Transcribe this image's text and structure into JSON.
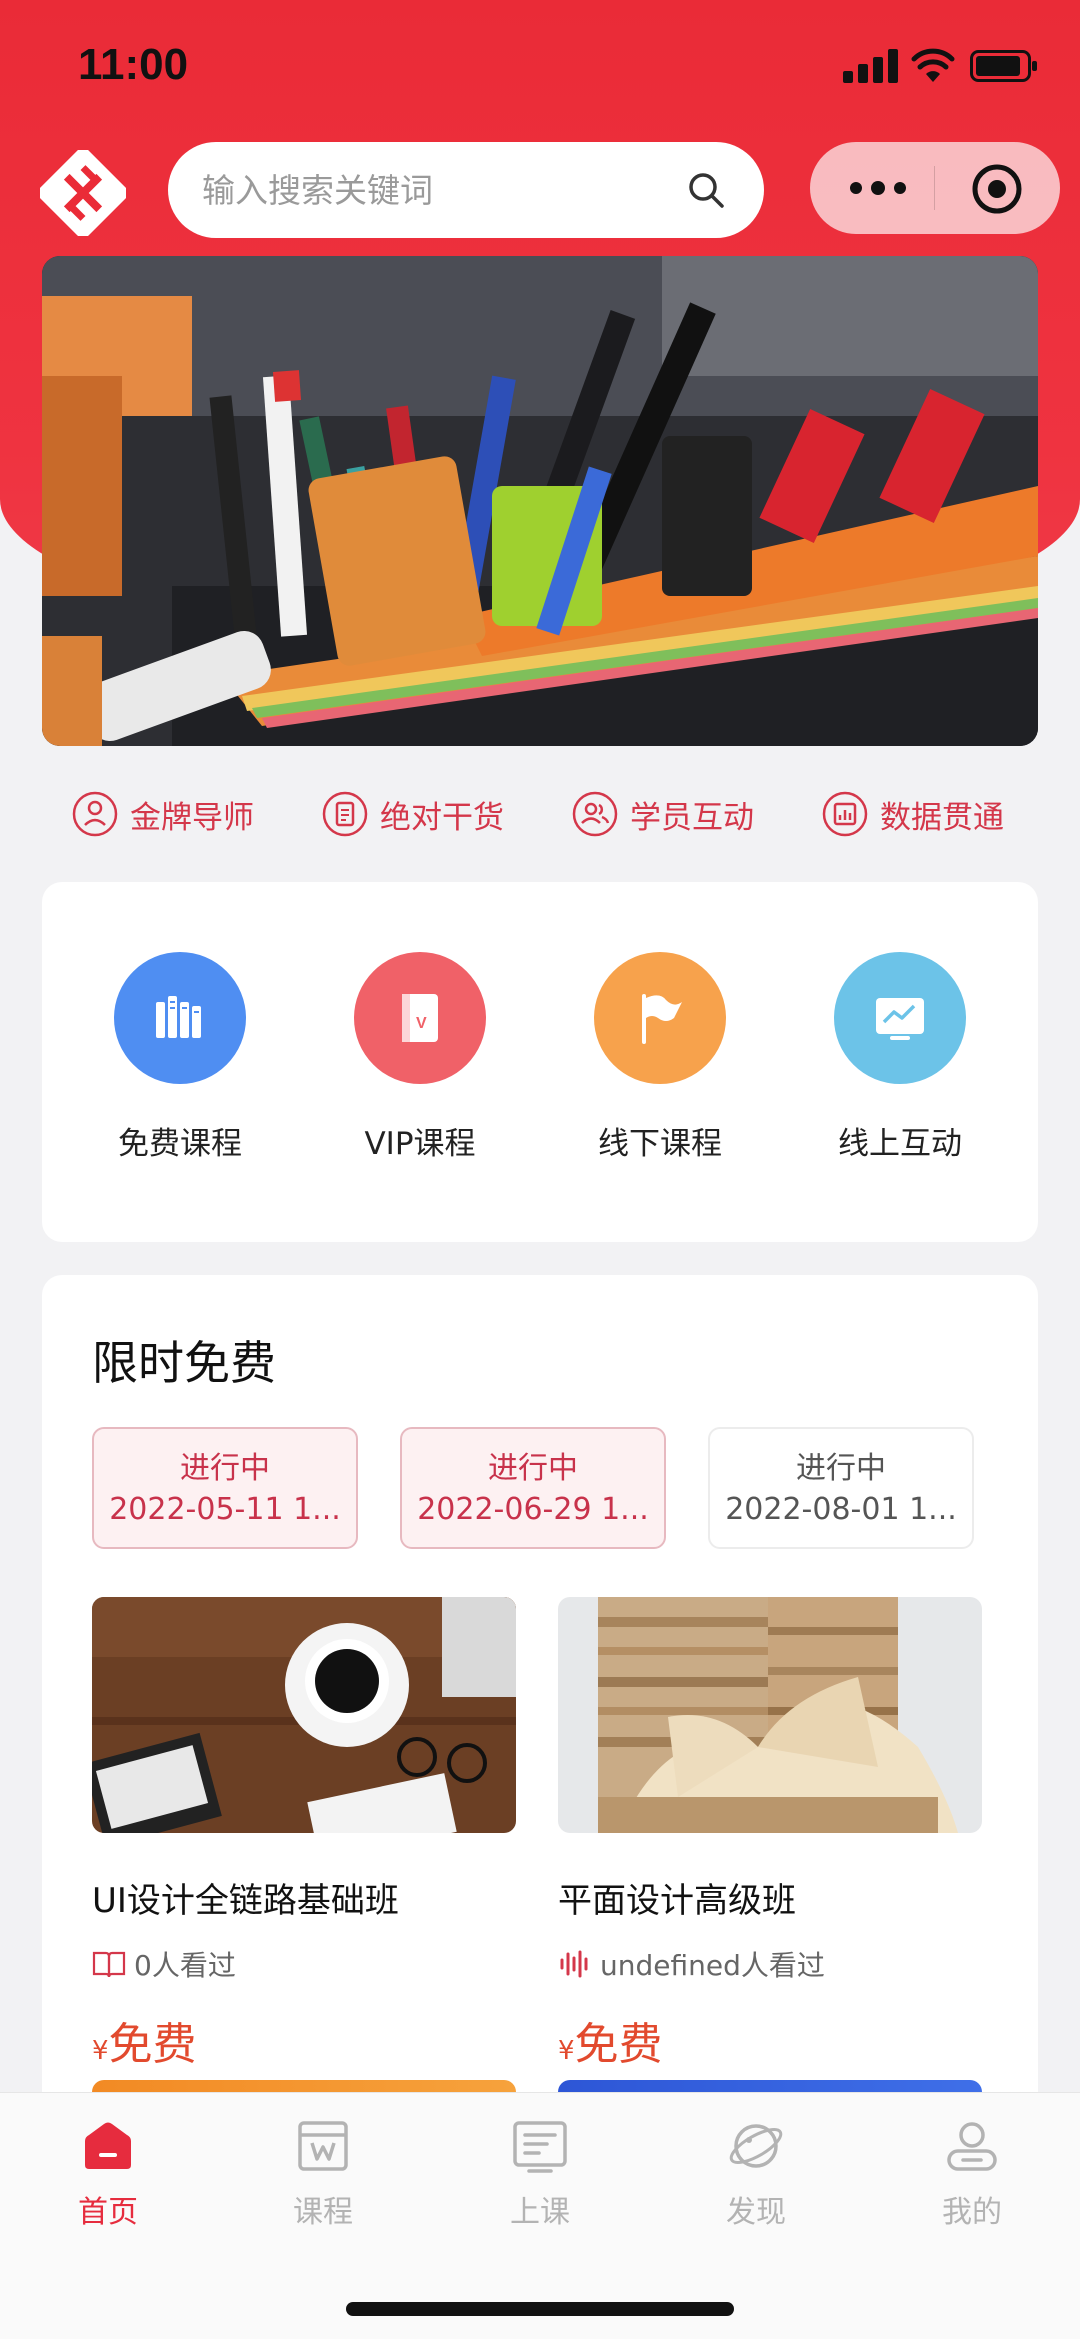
{
  "status_bar": {
    "time": "11:00"
  },
  "search": {
    "placeholder": "输入搜索关键词"
  },
  "features": [
    {
      "label": "金牌导师",
      "icon": "mentor-icon"
    },
    {
      "label": "绝对干货",
      "icon": "document-icon"
    },
    {
      "label": "学员互动",
      "icon": "users-icon"
    },
    {
      "label": "数据贯通",
      "icon": "data-chart-icon"
    }
  ],
  "categories": [
    {
      "label": "免费课程",
      "icon": "books-icon",
      "color": "#4f8ef2"
    },
    {
      "label": "VIP课程",
      "icon": "vip-book-icon",
      "color": "#f06168"
    },
    {
      "label": "线下课程",
      "icon": "flag-icon",
      "color": "#f7a24c"
    },
    {
      "label": "线上互动",
      "icon": "monitor-icon",
      "color": "#6cc3e8"
    }
  ],
  "limited_free": {
    "title": "限时免费",
    "sessions": [
      {
        "status": "进行中",
        "date": "2022-05-11 1...",
        "active": true
      },
      {
        "status": "进行中",
        "date": "2022-06-29 1...",
        "active": true
      },
      {
        "status": "进行中",
        "date": "2022-08-01 1...",
        "active": false
      }
    ],
    "courses": [
      {
        "title": "UI设计全链路基础班",
        "views": "0人看过",
        "currency": "¥",
        "price": "免费",
        "image": "coffee-desk-photo"
      },
      {
        "title": "平面设计高级班",
        "views": "undefined人看过",
        "currency": "¥",
        "price": "免费",
        "image": "books-photo"
      }
    ]
  },
  "tabbar": [
    {
      "label": "首页",
      "icon": "home-icon",
      "active": true
    },
    {
      "label": "课程",
      "icon": "course-icon",
      "active": false
    },
    {
      "label": "上课",
      "icon": "class-icon",
      "active": false
    },
    {
      "label": "发现",
      "icon": "planet-icon",
      "active": false
    },
    {
      "label": "我的",
      "icon": "profile-icon",
      "active": false
    }
  ],
  "colors": {
    "brand_red": "#ea2b37",
    "accent_text": "#d4374a",
    "price": "#e24a2e"
  }
}
